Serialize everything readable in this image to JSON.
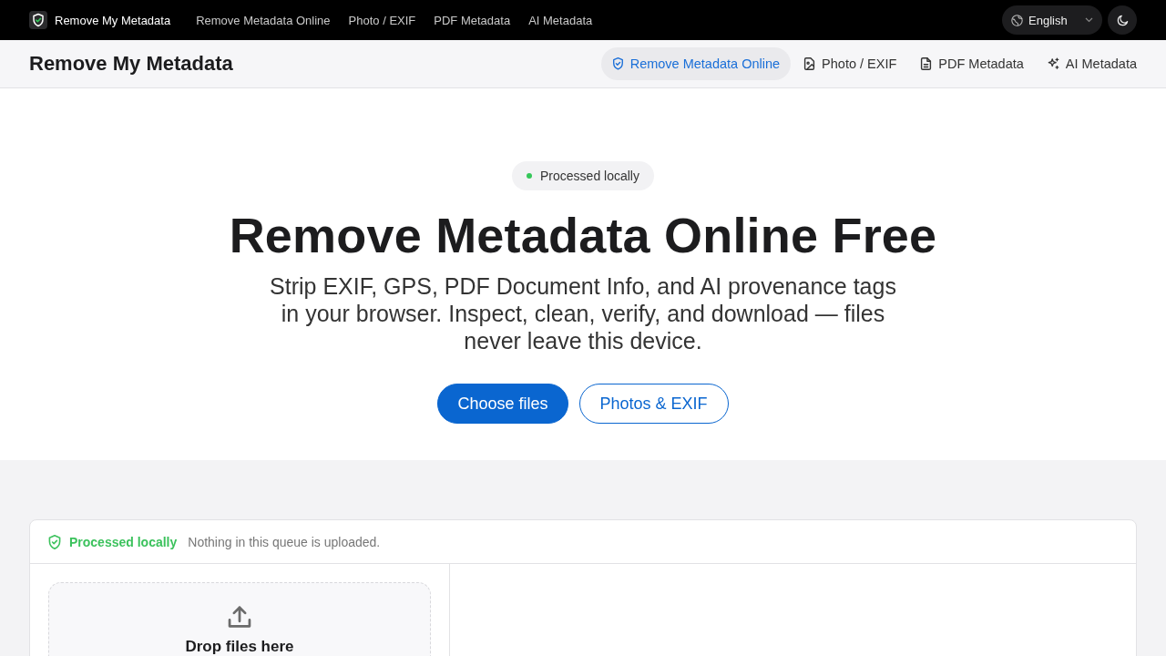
{
  "top_bar": {
    "brand": "Remove My Metadata",
    "links": [
      "Remove Metadata Online",
      "Photo / EXIF",
      "PDF Metadata",
      "AI Metadata"
    ],
    "language": "English"
  },
  "header": {
    "title": "Remove My Metadata",
    "tabs": [
      {
        "label": "Remove Metadata Online",
        "selected": true
      },
      {
        "label": "Photo / EXIF",
        "selected": false
      },
      {
        "label": "PDF Metadata",
        "selected": false
      },
      {
        "label": "AI Metadata",
        "selected": false
      }
    ]
  },
  "hero": {
    "badge": "Processed locally",
    "title": "Remove Metadata Online Free",
    "subtitle": "Strip EXIF, GPS, PDF Document Info, and AI provenance tags in your browser. Inspect, clean, verify, and download — files never leave this device.",
    "buttons": [
      {
        "label": "Choose files",
        "kind": "primary"
      },
      {
        "label": "Photos & EXIF",
        "kind": "secondary"
      }
    ]
  },
  "queue": {
    "status": "Processed locally",
    "note": "Nothing in this queue is uploaded.",
    "drop_zone": {
      "title": "Drop files here"
    }
  }
}
